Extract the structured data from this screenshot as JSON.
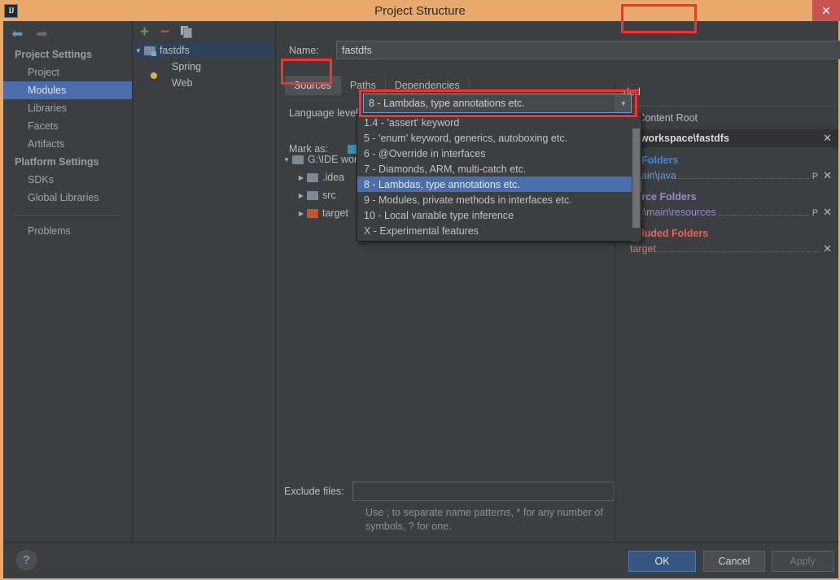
{
  "titlebar": {
    "app_icon": "IJ",
    "title": "Project Structure",
    "close_label": "✕"
  },
  "sidebar": {
    "nav": {
      "back_icon": "⬅",
      "forward_icon": "➡"
    },
    "sections": [
      {
        "header": "Project Settings",
        "items": [
          {
            "label": "Project",
            "selected": false
          },
          {
            "label": "Modules",
            "selected": true
          },
          {
            "label": "Libraries",
            "selected": false
          },
          {
            "label": "Facets",
            "selected": false
          },
          {
            "label": "Artifacts",
            "selected": false
          }
        ]
      },
      {
        "header": "Platform Settings",
        "items": [
          {
            "label": "SDKs",
            "selected": false
          },
          {
            "label": "Global Libraries",
            "selected": false
          }
        ]
      }
    ],
    "problems": "Problems"
  },
  "modules_panel": {
    "toolbar": {
      "add": "+",
      "remove": "−",
      "copy": "copy-icon"
    },
    "tree": [
      {
        "label": "fastdfs",
        "type": "module",
        "selected": true,
        "expanded": true,
        "indent": 0
      },
      {
        "label": "Spring",
        "type": "facet-spring",
        "selected": false,
        "indent": 1
      },
      {
        "label": "Web",
        "type": "facet-web",
        "selected": false,
        "indent": 1
      }
    ]
  },
  "main": {
    "name_label": "Name:",
    "name_value": "fastdfs",
    "tabs": [
      {
        "label": "Sources",
        "active": true
      },
      {
        "label": "Paths",
        "active": false
      },
      {
        "label": "Dependencies",
        "active": false
      }
    ],
    "language_level_label": "Language level:",
    "language_level_value": "8 - Lambdas, type annotations etc.",
    "combo_arrow": "▼",
    "mark_as_label": "Mark as:",
    "mark_sources": "S",
    "mark_excluded": "ded",
    "content_tree": [
      {
        "label": "G:\\IDE wor",
        "indent": 0,
        "expanded": true,
        "kind": "root"
      },
      {
        "label": ".idea",
        "indent": 1,
        "expanded": false,
        "kind": "folder"
      },
      {
        "label": "src",
        "indent": 1,
        "expanded": false,
        "kind": "folder"
      },
      {
        "label": "target",
        "indent": 1,
        "expanded": false,
        "kind": "excluded"
      }
    ],
    "exclude_files_label": "Exclude files:",
    "exclude_files_value": "",
    "exclude_hint": "Use ; to separate name patterns, * for any number of symbols, ? for one."
  },
  "dropdown": {
    "items": [
      {
        "label": "1.4 - 'assert' keyword",
        "selected": false
      },
      {
        "label": "5 - 'enum' keyword, generics, autoboxing etc.",
        "selected": false
      },
      {
        "label": "6 - @Override in interfaces",
        "selected": false
      },
      {
        "label": "7 - Diamonds, ARM, multi-catch etc.",
        "selected": false
      },
      {
        "label": "8 - Lambdas, type annotations etc.",
        "selected": true
      },
      {
        "label": "9 - Modules, private methods in interfaces etc.",
        "selected": false
      },
      {
        "label": "10 - Local variable type inference",
        "selected": false
      },
      {
        "label": "X - Experimental features",
        "selected": false
      }
    ]
  },
  "right_panel": {
    "excluded_text": "ded",
    "add_content_root": "dd Content Root",
    "content_root": "DE workspace\\fastdfs",
    "content_root_remove": "✕",
    "groups": [
      {
        "title": "rce Folders",
        "kind": "src",
        "paths": [
          {
            "path": "\\main\\java",
            "props": "P",
            "remove": "✕"
          }
        ]
      },
      {
        "title": "source Folders",
        "kind": "res",
        "paths": [
          {
            "path": "src\\main\\resources",
            "props": "P",
            "remove": "✕"
          }
        ]
      },
      {
        "title": "Excluded Folders",
        "kind": "exc",
        "paths": [
          {
            "path": "target",
            "props": "",
            "remove": "✕"
          }
        ]
      }
    ]
  },
  "bottom": {
    "help_icon": "?",
    "ok_label": "OK",
    "cancel_label": "Cancel",
    "apply_label": "Apply"
  },
  "highlights": {
    "accent_red": "#ff2d2d",
    "selection_blue": "#4b6eaf",
    "ok_blue": "#365880"
  }
}
